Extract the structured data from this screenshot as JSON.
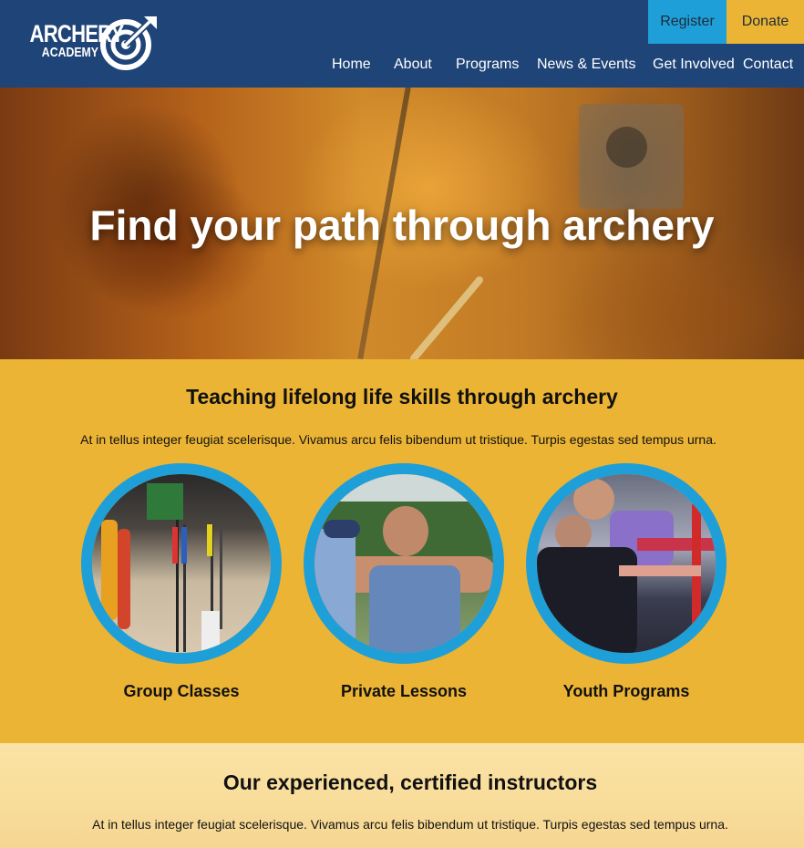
{
  "brand": {
    "logo_line1": "ARCHERY",
    "logo_line2": "ACADEMY",
    "logo_icon": "target-arrow-icon",
    "primary_color": "#1f4477",
    "accent_blue": "#1f9fd8",
    "accent_yellow": "#ecb434"
  },
  "header": {
    "register_label": "Register",
    "donate_label": "Donate",
    "nav": [
      "Home",
      "About",
      "Programs",
      "News & Events",
      "Get Involved",
      "Contact"
    ]
  },
  "hero": {
    "title": "Find your path through archery"
  },
  "skills": {
    "title": "Teaching lifelong life skills through archery",
    "text": "At in tellus integer feugiat scelerisque. Vivamus arcu felis bibendum ut tristique. Turpis egestas sed tempus urna.",
    "cards": [
      {
        "label": "Group Classes"
      },
      {
        "label": "Private Lessons"
      },
      {
        "label": "Youth Programs"
      }
    ]
  },
  "instructors": {
    "title": "Our experienced, certified instructors",
    "text": "At in tellus integer feugiat scelerisque. Vivamus arcu felis bibendum ut tristique. Turpis egestas sed tempus urna."
  }
}
